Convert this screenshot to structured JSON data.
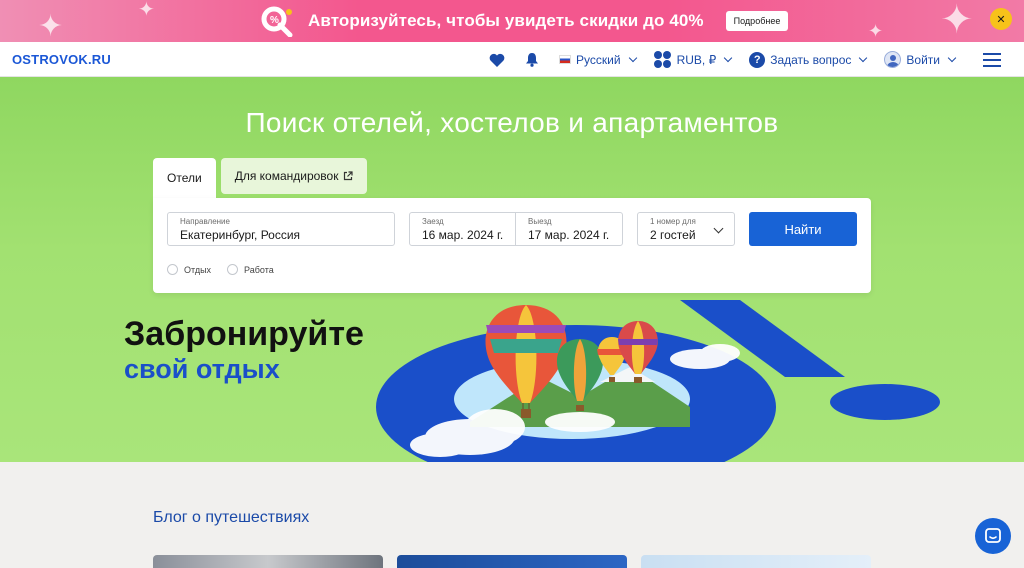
{
  "promo": {
    "text": "Авторизуйтесь, чтобы увидеть скидки до 40%",
    "button_label": "Подробнее",
    "close_label": "✕"
  },
  "nav": {
    "logo": "OSTROVOK.RU",
    "language": "Русский",
    "currency": "RUB, ₽",
    "help": "Задать вопрос",
    "login": "Войти",
    "help_glyph": "?"
  },
  "hero": {
    "title": "Поиск отелей, хостелов и апартаментов",
    "tabs": [
      {
        "label": "Отели"
      },
      {
        "label": "Для командировок"
      }
    ],
    "search": {
      "destination": {
        "label": "Направление",
        "value": "Екатеринбург, Россия"
      },
      "checkin": {
        "label": "Заезд",
        "value": "16 мар. 2024 г."
      },
      "checkout": {
        "label": "Выезд",
        "value": "17 мар. 2024 г."
      },
      "guests": {
        "label": "1 номер для",
        "value": "2 гостей"
      },
      "submit": "Найти",
      "trip_types": [
        {
          "label": "Отдых"
        },
        {
          "label": "Работа"
        }
      ]
    },
    "headline_line1": "Забронируйте",
    "headline_line2": "свой отдых"
  },
  "blog": {
    "title": "Блог о путешествиях"
  },
  "colors": {
    "brand_blue": "#1863d6",
    "promo_pink": "#f3578e",
    "hero_green": "#a2e171",
    "close_yellow": "#f7c21a"
  },
  "icons": [
    "heart-icon",
    "bell-icon",
    "flag-ru-icon",
    "currency-icon",
    "help-icon",
    "user-icon",
    "menu-icon",
    "external-link-icon",
    "chevron-down-icon",
    "chat-icon"
  ]
}
